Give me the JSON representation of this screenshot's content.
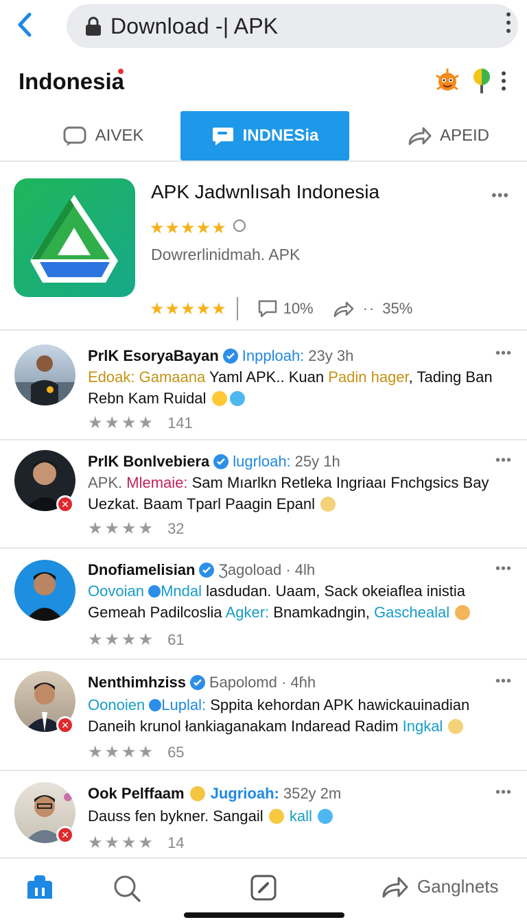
{
  "browser": {
    "url_text": "Download -| APK"
  },
  "header": {
    "title": "Indonesia"
  },
  "tabs": [
    {
      "label": "AIVEK",
      "icon": "chat-bubble-icon"
    },
    {
      "label": "INDNESia",
      "icon": "message-icon",
      "active": true
    },
    {
      "label": "APEID",
      "icon": "share-icon"
    }
  ],
  "app": {
    "title": "APK Jadwnlısah Indonesia",
    "subtitle": "Dowrerlinidmah. APK",
    "comments": "10%",
    "shares": "35%",
    "colors": {
      "icon_bg": "#1fb65a",
      "accent": "#1e98e8",
      "star": "#f5b21b"
    }
  },
  "posts": [
    {
      "name": "PrlK EsoryaBayan",
      "handle": "Inpploah:",
      "time": "23y  3h",
      "line1": [
        "Edoak: Gamaana",
        " Yaml APK.. Kuan ",
        "Padin hager",
        ", Tading Ban"
      ],
      "line2": "Rebn Kam Ruidal",
      "rating_count": "141"
    },
    {
      "name": "PrlK Bonlvebiera",
      "handle": "lugrloah:",
      "time": "25y  1h",
      "line1": [
        "APK. ",
        "Mlemaie:",
        " Sam Mıarlkn Retleka Ingriaaı Fnchgsics Bay"
      ],
      "line2": "Uezkat. Baam Tparl Paagin Epanl",
      "rating_count": "32"
    },
    {
      "name": "Dnofiamelisian",
      "handle": "Ʒagoload · 4lh",
      "time": "",
      "line1": [
        "Oovoian ",
        "Mndal",
        " lasdudan. Uaam, Sack okeiaflea inistia"
      ],
      "line2": [
        "Gemeah Padilcoslia ",
        "Agker:",
        " Bnamkadngin, ",
        "Gaschealal"
      ],
      "rating_count": "61"
    },
    {
      "name": "Nenthimhziss",
      "handle": "Бapolomd · 4ɦh",
      "time": "",
      "line1": [
        "Oonoien ",
        "Luplal:",
        " Sppita kehordan APK hawickauinadian"
      ],
      "line2": [
        "Daneih krunol łankiaganakam Indaread Radim ",
        "Ingkal"
      ],
      "rating_count": "65"
    },
    {
      "name": "Ook Pelffaam",
      "handle": "Jugrioah:",
      "time": "352y  2m",
      "line1": [
        "Dauss fen bykner. Sangail ",
        "kall"
      ],
      "line2": "",
      "rating_count": "14"
    }
  ],
  "bottom_nav": {
    "gangnets_label": "Ganglnets"
  }
}
